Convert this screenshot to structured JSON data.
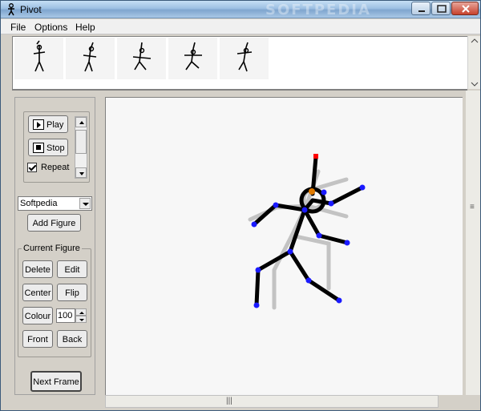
{
  "window": {
    "title": "Pivot",
    "watermark": "SOFTPEDIA"
  },
  "menu": [
    "File",
    "Options",
    "Help"
  ],
  "frames": {
    "count": 5,
    "items": [
      "frame-1",
      "frame-2",
      "frame-3",
      "frame-4",
      "frame-5"
    ]
  },
  "playback": {
    "play_label": "Play",
    "stop_label": "Stop",
    "repeat_label": "Repeat",
    "repeat_checked": true
  },
  "figure_select": {
    "selected": "Softpedia"
  },
  "add_figure_label": "Add Figure",
  "current_figure": {
    "legend": "Current Figure",
    "delete_label": "Delete",
    "edit_label": "Edit",
    "center_label": "Center",
    "flip_label": "Flip",
    "colour_label": "Colour",
    "colour_value": "100",
    "front_label": "Front",
    "back_label": "Back"
  },
  "next_frame_label": "Next Frame",
  "colors": {
    "joint": "#1a1aff",
    "handle_root": "#ff0000",
    "handle_center": "#e07a00",
    "ghost": "#c0c0c0",
    "figure": "#000000"
  }
}
